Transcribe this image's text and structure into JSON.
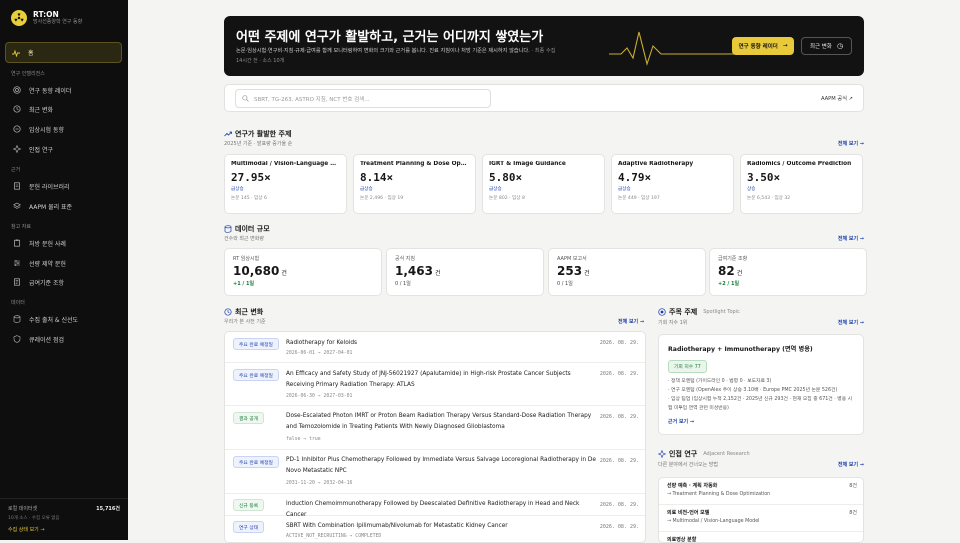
{
  "sidebar": {
    "brand": {
      "name": "RT:ON",
      "subtitle": "방사선종양학 연구 동향"
    },
    "home": "홈",
    "groups": [
      {
        "label": "연구 인텔리전스",
        "items": [
          "연구 동향 레이더",
          "최근 변화",
          "임상시험 동향",
          "인접 연구"
        ]
      },
      {
        "label": "근거",
        "items": [
          "문헌 라이브러리",
          "AAPM 물리 표준"
        ]
      },
      {
        "label": "참고 자료",
        "items": [
          "처방 문헌 사례",
          "선량 제약 문헌",
          "급여기준 조항"
        ]
      },
      {
        "label": "데이터",
        "items": [
          "수집 출처 & 신선도",
          "큐레이션 점검"
        ]
      }
    ],
    "footer": {
      "label": "로컬 데이터셋",
      "count": "15,716건",
      "meta": "10개 소스 · 수집 오류 없음",
      "link": "수집 상태 보기 →"
    }
  },
  "hero": {
    "title": "어떤 주제에 연구가 활발하고, 근거는 어디까지 쌓였는가",
    "desc": "논문·임상시험·연구비·지침·규제·급여를 함께 모니터링하여 변화의 크기와 근거를 봅니다. 진료 지침이나 처방 기준은 제시하지 않습니다.",
    "desc_muted": "· 최종 수집",
    "meta": "14시간 전 · 소스 10개",
    "btn_primary": "연구 동향 레이더",
    "btn_secondary": "최근 변화"
  },
  "search": {
    "placeholder": "SBRT, TG-263, ASTRO 지침, NCT 번호 검색...",
    "aapm_link": "AAPM 공식"
  },
  "topics": {
    "title": "연구가 활발한 주제",
    "subtitle": "2025년 기준 · 발표량 증가율 순",
    "more": "전체 보기 →",
    "cards": [
      {
        "name": "Multimodal / Vision-Language Model",
        "value": "27.95×",
        "trend": "급상승",
        "meta": "논문 145 · 임상 6"
      },
      {
        "name": "Treatment Planning & Dose Optimization",
        "value": "8.14×",
        "trend": "급상승",
        "meta": "논문 2,496 · 임상 19"
      },
      {
        "name": "IGRT & Image Guidance",
        "value": "5.80×",
        "trend": "급상승",
        "meta": "논문 802 · 임상 8"
      },
      {
        "name": "Adaptive Radiotherapy",
        "value": "4.79×",
        "trend": "급상승",
        "meta": "논문 449 · 임상 197"
      },
      {
        "name": "Radiomics / Outcome Prediction",
        "value": "3.50×",
        "trend": "상승",
        "meta": "논문 6,543 · 임상 32"
      }
    ]
  },
  "data_scale": {
    "title": "데이터 규모",
    "subtitle": "건수와 최근 변화량",
    "more": "전체 보기 →",
    "cards": [
      {
        "name": "RT 임상시험",
        "value": "10,680",
        "unit": "건",
        "delta": "+1 / 1일",
        "up": true
      },
      {
        "name": "공식 지침",
        "value": "1,463",
        "unit": "건",
        "delta": "0 / 1일",
        "up": false
      },
      {
        "name": "AAPM 보고서",
        "value": "253",
        "unit": "건",
        "delta": "0 / 1일",
        "up": false
      },
      {
        "name": "급여기준 조항",
        "value": "82",
        "unit": "건",
        "delta": "+2 / 1일",
        "up": true
      }
    ]
  },
  "changes": {
    "title": "최근 변화",
    "subtitle": "우리가 본 사전 기준",
    "more": "전체 보기 →",
    "items": [
      {
        "badge": "주요 완료 예정일",
        "title": "Radiotherapy for Keloids",
        "meta": "2026-06-01 → 2027-04-01",
        "date": "2026. 08. 29."
      },
      {
        "badge": "주요 완료 예정일",
        "title": "An Efficacy and Safety Study of JNJ-56021927 (Apalutamide) in High-risk Prostate Cancer Subjects Receiving Primary Radiation Therapy: ATLAS",
        "meta": "2026-06-30 → 2027-03-01",
        "date": "2026. 08. 29."
      },
      {
        "badge": "결과 공개",
        "title": "Dose-Escalated Photon IMRT or Proton Beam Radiation Therapy Versus Standard-Dose Radiation Therapy and Temozolomide in Treating Patients With Newly Diagnosed Glioblastoma",
        "meta": "false → true",
        "date": "2026. 08. 29."
      },
      {
        "badge": "주요 완료 예정일",
        "title": "PD-1 Inhibitor Plus Chemotherapy Followed by Immediate Versus Salvage Locoregional Radiotherapy in De Novo Metastatic NPC",
        "meta": "2031-11-20 → 2032-04-16",
        "date": "2026. 08. 29."
      },
      {
        "badge": "신규 등록",
        "title": "Induction Chemoimmunotherapy Followed by Deescalated Definitive Radiotherapy in Head and Neck Cancer",
        "meta": "",
        "date": "2026. 08. 29."
      },
      {
        "badge": "연구 상태",
        "title": "SBRT With Combination Ipilimumab/Nivolumab for Metastatic Kidney Cancer",
        "meta": "ACTIVE_NOT_RECRUITING → COMPLETED",
        "date": "2026. 08. 29."
      }
    ]
  },
  "spotlight": {
    "title": "주목 주제",
    "title_en": "Spotlight Topic",
    "subtitle": "기회 지수 1위",
    "more": "전체 보기 →",
    "topic": "Radiotherapy + Immunotherapy (면역 병용)",
    "badge": "기회 지수 77",
    "lines": [
      "· 정책 모멘텀 (가이드라인 0 · 법령 0 · 보도자료 3)",
      "· 연구 모멘텀 (OpenAlex 주이 상승 3.10배 · Europe PMC 2025년 논문 526건)",
      "· 임상 팀업 (임상시험 누적 2,152건 · 2025년 신규 293건 · 현재 모집 중 671건 · 병용 시험 미투입 면역 관련 미성반응)"
    ],
    "link": "근거 보기 →"
  },
  "adjacent": {
    "title": "인접 연구",
    "title_en": "Adjacent Research",
    "subtitle": "다른 분야에서 건너오는 방법",
    "more": "전체 보기 →",
    "items": [
      {
        "name": "선량 예측 · 계획 자동화",
        "related": "→ Treatment Planning & Dose Optimization",
        "count": "8건"
      },
      {
        "name": "의료 비전-언어 모델",
        "related": "→ Multimodal / Vision-Language Model",
        "count": "8건"
      },
      {
        "name": "의료영상 분할",
        "related": "",
        "count": ""
      }
    ]
  }
}
